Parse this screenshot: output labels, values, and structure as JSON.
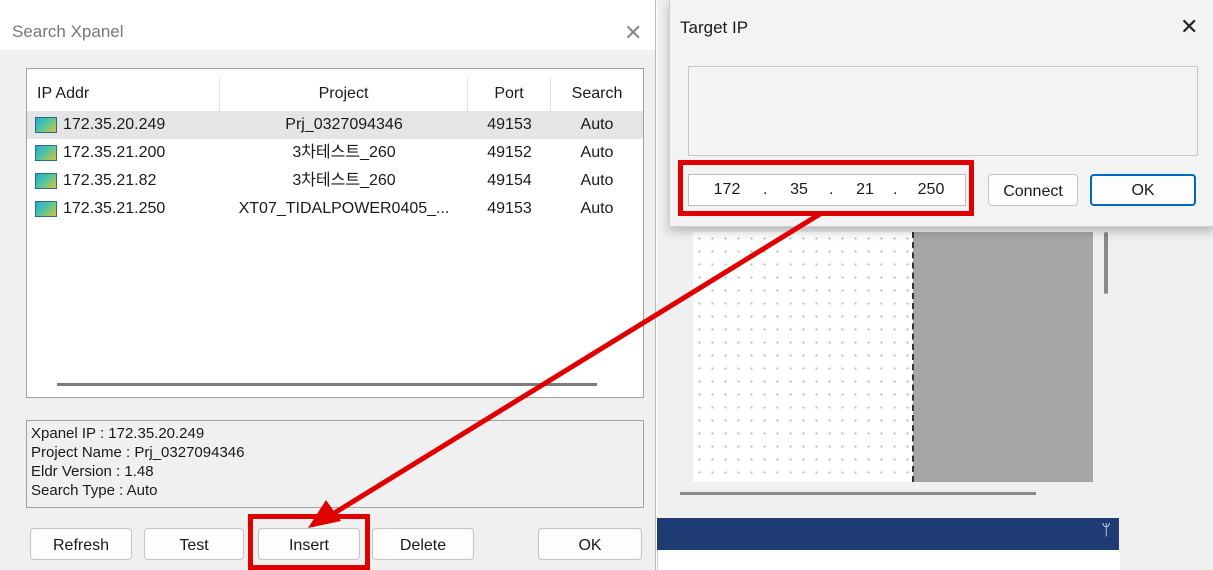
{
  "search_dialog": {
    "title": "Search Xpanel",
    "close_glyph": "✕",
    "columns": [
      "IP Addr",
      "Project",
      "Port",
      "Search"
    ],
    "rows": [
      {
        "ip": "172.35.20.249",
        "project": "Prj_0327094346",
        "port": "49153",
        "search": "Auto"
      },
      {
        "ip": "172.35.21.200",
        "project": "3차테스트_260",
        "port": "49152",
        "search": "Auto"
      },
      {
        "ip": "172.35.21.82",
        "project": "3차테스트_260",
        "port": "49154",
        "search": "Auto"
      },
      {
        "ip": "172.35.21.250",
        "project": "XT07_TIDALPOWER0405_...",
        "port": "49153",
        "search": "Auto"
      }
    ],
    "selected_row": 0,
    "row_icon": "network-panel-icon",
    "info": {
      "line1": "Xpanel IP : 172.35.20.249",
      "line2": "Project Name : Prj_0327094346",
      "line3": "Eldr Version : 1.48",
      "line4": "Search Type : Auto"
    },
    "buttons": {
      "refresh": "Refresh",
      "test": "Test",
      "insert": "Insert",
      "delete": "Delete",
      "ok": "OK"
    }
  },
  "target_dialog": {
    "title": "Target IP",
    "close_glyph": "✕",
    "ip": {
      "o1": "172",
      "o2": "35",
      "o3": "21",
      "o4": "250",
      "sep": "."
    },
    "buttons": {
      "connect": "Connect",
      "ok": "OK"
    }
  },
  "workspace": {
    "pin_glyph": "ᛘ"
  },
  "colors": {
    "annotation": "#e00000",
    "panel_header": "#1f3b73",
    "primary_button_border": "#0067c0"
  },
  "icons": {
    "close": "close-icon",
    "pin": "pin-icon",
    "row": "network-panel-icon"
  }
}
